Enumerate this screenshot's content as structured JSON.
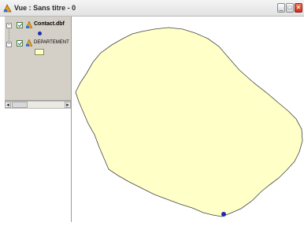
{
  "window": {
    "title": "Vue : Sans titre - 0",
    "minimize_label": "_",
    "maximize_label": "□",
    "close_label": "×"
  },
  "toc": {
    "layers": [
      {
        "name": "Contact.dbf",
        "checked": true,
        "expanded": true,
        "symbol": "blue-point"
      },
      {
        "name": "DEPARTEMENT",
        "checked": true,
        "expanded": true,
        "symbol": "yellow-polygon"
      }
    ],
    "scroll_left": "◄",
    "scroll_right": "►"
  },
  "map": {
    "island_fill": "#ffffc8",
    "island_stroke": "#444444",
    "point_color": "#1a2bb8"
  }
}
